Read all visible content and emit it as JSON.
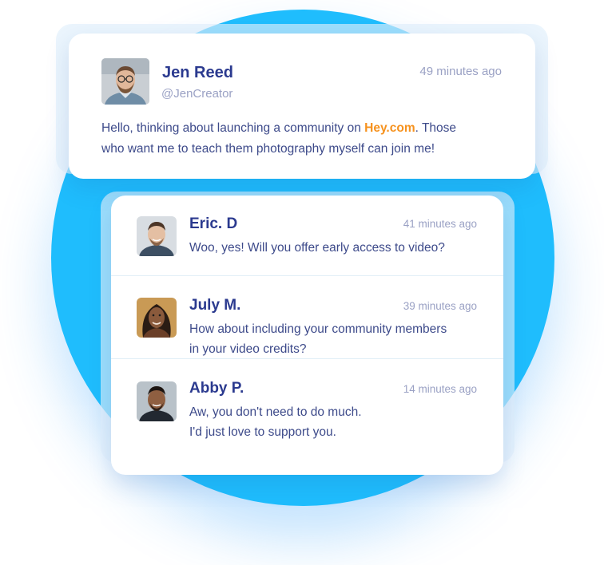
{
  "post": {
    "author_name": "Jen Reed",
    "handle": "@JenCreator",
    "time": "49 minutes ago",
    "text_before": "Hello, thinking about launching a community on ",
    "link_text": "Hey.com",
    "text_after_line1": ". Those",
    "text_line2": "who want me to teach them photography myself can join me!"
  },
  "replies": [
    {
      "name": "Eric. D",
      "time": "41 minutes ago",
      "lines": [
        "Woo, yes! Will you offer early access to video?"
      ]
    },
    {
      "name": "July M.",
      "time": "39 minutes ago",
      "lines": [
        "How about including your community members",
        "in your video credits?"
      ]
    },
    {
      "name": "Abby P.",
      "time": "14 minutes ago",
      "lines": [
        "Aw, you don't need to do much.",
        "I'd just love to support you."
      ]
    }
  ],
  "colors": {
    "accent_blue": "#1fbdfd",
    "name_text": "#2b3a8f",
    "muted_text": "#9aa1c4",
    "link_orange": "#f6921e"
  }
}
